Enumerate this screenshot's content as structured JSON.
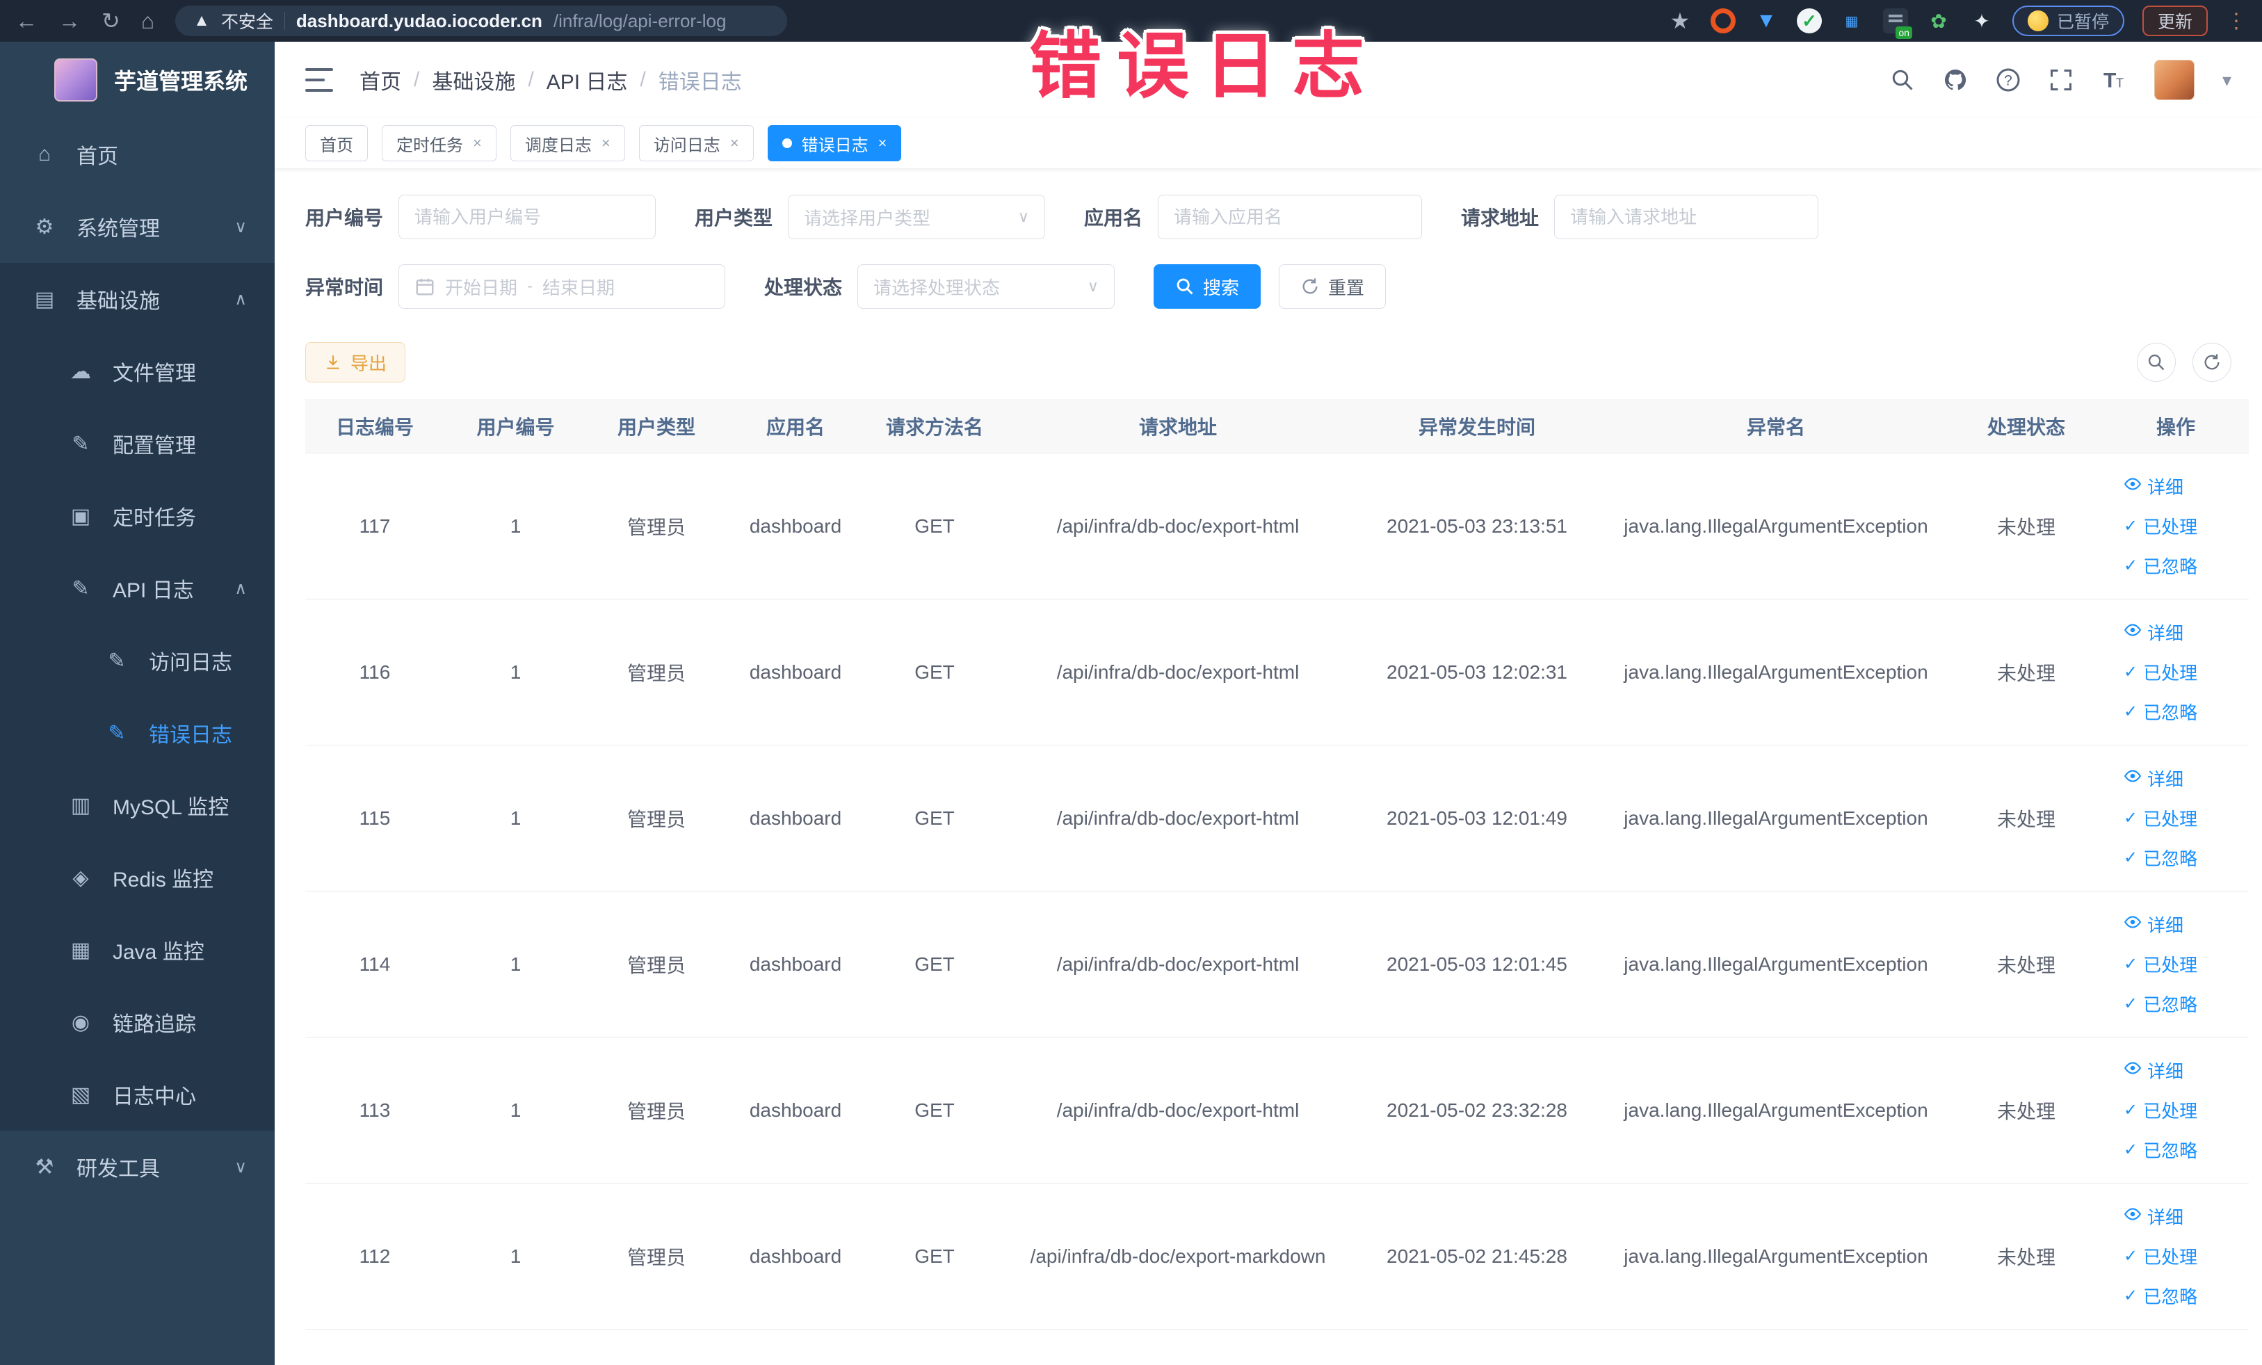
{
  "browser": {
    "security_label": "不安全",
    "url_host": "dashboard.yudao.iocoder.cn",
    "url_path": "/infra/log/api-error-log",
    "paused_label": "已暂停",
    "update_label": "更新"
  },
  "overlay": {
    "title": "错误日志",
    "color": "#f5365c"
  },
  "sidebar": {
    "app_title": "芋道管理系统",
    "items": [
      {
        "key": "home",
        "label": "首页",
        "icon": "home",
        "level": 0,
        "expandable": false,
        "dark": false,
        "active": false
      },
      {
        "key": "system-mgmt",
        "label": "系统管理",
        "icon": "gear",
        "level": 0,
        "expandable": true,
        "expanded": false,
        "dark": false,
        "active": false
      },
      {
        "key": "infrastructure",
        "label": "基础设施",
        "icon": "infra",
        "level": 0,
        "expandable": true,
        "expanded": true,
        "dark": true,
        "active": false
      },
      {
        "key": "file-mgmt",
        "label": "文件管理",
        "icon": "cloud",
        "level": 1,
        "expandable": false,
        "dark": true,
        "active": false
      },
      {
        "key": "config-mgmt",
        "label": "配置管理",
        "icon": "edit",
        "level": 1,
        "expandable": false,
        "dark": true,
        "active": false
      },
      {
        "key": "cron-job",
        "label": "定时任务",
        "icon": "job",
        "level": 1,
        "expandable": false,
        "dark": true,
        "active": false
      },
      {
        "key": "api-log",
        "label": "API 日志",
        "icon": "log",
        "level": 1,
        "expandable": true,
        "expanded": true,
        "dark": true,
        "active": false
      },
      {
        "key": "access-log",
        "label": "访问日志",
        "icon": "log",
        "level": 2,
        "expandable": false,
        "dark": true,
        "active": false
      },
      {
        "key": "error-log",
        "label": "错误日志",
        "icon": "log",
        "level": 2,
        "expandable": false,
        "dark": true,
        "active": true
      },
      {
        "key": "mysql-monitor",
        "label": "MySQL 监控",
        "icon": "mysql",
        "level": 1,
        "expandable": false,
        "dark": true,
        "active": false
      },
      {
        "key": "redis-monitor",
        "label": "Redis 监控",
        "icon": "redis",
        "level": 1,
        "expandable": false,
        "dark": true,
        "active": false
      },
      {
        "key": "java-monitor",
        "label": "Java 监控",
        "icon": "java",
        "level": 1,
        "expandable": false,
        "dark": true,
        "active": false
      },
      {
        "key": "trace",
        "label": "链路追踪",
        "icon": "eye",
        "level": 1,
        "expandable": false,
        "dark": true,
        "active": false
      },
      {
        "key": "log-center",
        "label": "日志中心",
        "icon": "logcenter",
        "level": 1,
        "expandable": false,
        "dark": true,
        "active": false
      },
      {
        "key": "dev-tools",
        "label": "研发工具",
        "icon": "tools",
        "level": 0,
        "expandable": true,
        "expanded": false,
        "dark": false,
        "active": false
      }
    ]
  },
  "breadcrumb": {
    "items": [
      "首页",
      "基础设施",
      "API 日志",
      "错误日志"
    ]
  },
  "tabs": [
    {
      "label": "首页",
      "closable": false,
      "active": false
    },
    {
      "label": "定时任务",
      "closable": true,
      "active": false
    },
    {
      "label": "调度日志",
      "closable": true,
      "active": false
    },
    {
      "label": "访问日志",
      "closable": true,
      "active": false
    },
    {
      "label": "错误日志",
      "closable": true,
      "active": true
    }
  ],
  "filters": {
    "user_id": {
      "label": "用户编号",
      "placeholder": "请输入用户编号"
    },
    "user_type": {
      "label": "用户类型",
      "placeholder": "请选择用户类型"
    },
    "app_name": {
      "label": "应用名",
      "placeholder": "请输入应用名"
    },
    "request_url": {
      "label": "请求地址",
      "placeholder": "请输入请求地址"
    },
    "exception_time": {
      "label": "异常时间",
      "start_placeholder": "开始日期",
      "separator": "-",
      "end_placeholder": "结束日期"
    },
    "process_status": {
      "label": "处理状态",
      "placeholder": "请选择处理状态"
    },
    "search_label": "搜索",
    "reset_label": "重置"
  },
  "toolbar": {
    "export_label": "导出"
  },
  "table": {
    "columns": [
      "日志编号",
      "用户编号",
      "用户类型",
      "应用名",
      "请求方法名",
      "请求地址",
      "异常发生时间",
      "异常名",
      "处理状态",
      "操作"
    ],
    "actions": [
      {
        "label": "详细",
        "icon": "eye"
      },
      {
        "label": "已处理",
        "icon": "check"
      },
      {
        "label": "已忽略",
        "icon": "check"
      }
    ],
    "rows": [
      {
        "id": "117",
        "user_id": "1",
        "user_type": "管理员",
        "app_name": "dashboard",
        "method": "GET",
        "url": "/api/infra/db-doc/export-html",
        "time": "2021-05-03 23:13:51",
        "exception": "java.lang.IllegalArgumentException",
        "status": "未处理"
      },
      {
        "id": "116",
        "user_id": "1",
        "user_type": "管理员",
        "app_name": "dashboard",
        "method": "GET",
        "url": "/api/infra/db-doc/export-html",
        "time": "2021-05-03 12:02:31",
        "exception": "java.lang.IllegalArgumentException",
        "status": "未处理"
      },
      {
        "id": "115",
        "user_id": "1",
        "user_type": "管理员",
        "app_name": "dashboard",
        "method": "GET",
        "url": "/api/infra/db-doc/export-html",
        "time": "2021-05-03 12:01:49",
        "exception": "java.lang.IllegalArgumentException",
        "status": "未处理"
      },
      {
        "id": "114",
        "user_id": "1",
        "user_type": "管理员",
        "app_name": "dashboard",
        "method": "GET",
        "url": "/api/infra/db-doc/export-html",
        "time": "2021-05-03 12:01:45",
        "exception": "java.lang.IllegalArgumentException",
        "status": "未处理"
      },
      {
        "id": "113",
        "user_id": "1",
        "user_type": "管理员",
        "app_name": "dashboard",
        "method": "GET",
        "url": "/api/infra/db-doc/export-html",
        "time": "2021-05-02 23:32:28",
        "exception": "java.lang.IllegalArgumentException",
        "status": "未处理"
      },
      {
        "id": "112",
        "user_id": "1",
        "user_type": "管理员",
        "app_name": "dashboard",
        "method": "GET",
        "url": "/api/infra/db-doc/export-markdown",
        "time": "2021-05-02 21:45:28",
        "exception": "java.lang.IllegalArgumentException",
        "status": "未处理"
      }
    ]
  },
  "colors": {
    "accent": "#1890ff",
    "sidebar_active": "#409eff",
    "export_text": "#e6a23c",
    "overlay_red": "#f5365c"
  }
}
